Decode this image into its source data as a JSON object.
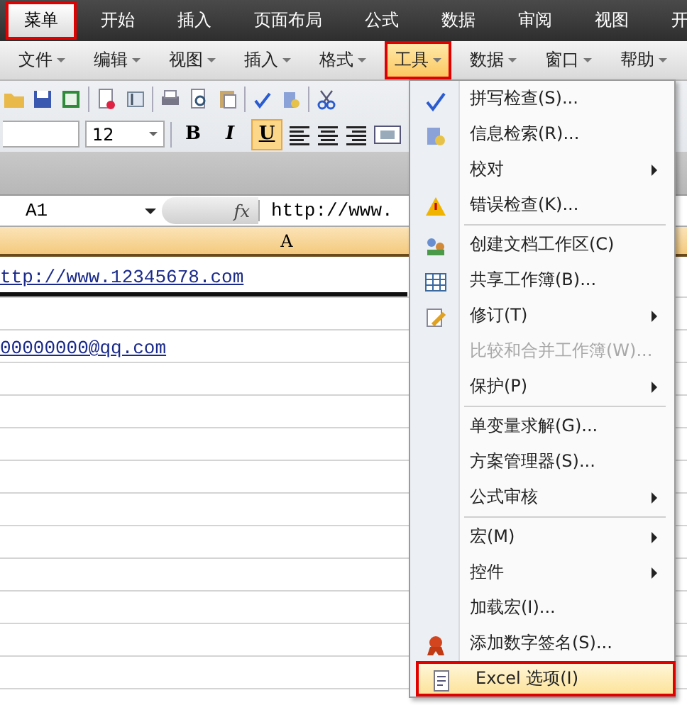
{
  "ribbon_tabs": [
    {
      "label": "菜单",
      "selected": true,
      "annotated": true
    },
    {
      "label": "开始",
      "selected": false,
      "annotated": false
    },
    {
      "label": "插入",
      "selected": false,
      "annotated": false
    },
    {
      "label": "页面布局",
      "selected": false,
      "annotated": false
    },
    {
      "label": "公式",
      "selected": false,
      "annotated": false
    },
    {
      "label": "数据",
      "selected": false,
      "annotated": false
    },
    {
      "label": "审阅",
      "selected": false,
      "annotated": false
    },
    {
      "label": "视图",
      "selected": false,
      "annotated": false
    },
    {
      "label": "开",
      "selected": false,
      "annotated": false
    }
  ],
  "menu_bar": [
    {
      "label": "文件",
      "selected": false,
      "annotated": false
    },
    {
      "label": "编辑",
      "selected": false,
      "annotated": false
    },
    {
      "label": "视图",
      "selected": false,
      "annotated": false
    },
    {
      "label": "插入",
      "selected": false,
      "annotated": false
    },
    {
      "label": "格式",
      "selected": false,
      "annotated": false
    },
    {
      "label": "工具",
      "selected": true,
      "annotated": true
    },
    {
      "label": "数据",
      "selected": false,
      "annotated": false
    },
    {
      "label": "窗口",
      "selected": false,
      "annotated": false
    },
    {
      "label": "帮助",
      "selected": false,
      "annotated": false
    }
  ],
  "font_size": {
    "value": "12"
  },
  "format_buttons": [
    {
      "label": "B",
      "pressed": false
    },
    {
      "label": "I",
      "pressed": false
    },
    {
      "label": "U",
      "pressed": true
    }
  ],
  "name_box": {
    "value": "A1"
  },
  "formula_bar": {
    "function_label": "fx",
    "value": "http://www."
  },
  "column_header": "A",
  "rows": [
    {
      "text": "ttp://www.12345678.com",
      "selected": true
    },
    null,
    {
      "text": "00000000@qq.com",
      "selected": false
    }
  ],
  "tools_menu": [
    {
      "kind": "item",
      "label": "拼写检查(S)...",
      "has_icon": true,
      "submenu": false,
      "disabled": false,
      "annotated": false
    },
    {
      "kind": "item",
      "label": "信息检索(R)...",
      "has_icon": true,
      "submenu": false,
      "disabled": false,
      "annotated": false
    },
    {
      "kind": "item",
      "label": "校对",
      "has_icon": false,
      "submenu": true,
      "disabled": false,
      "annotated": false
    },
    {
      "kind": "item",
      "label": "错误检查(K)...",
      "has_icon": true,
      "submenu": false,
      "disabled": false,
      "annotated": false
    },
    {
      "kind": "separator"
    },
    {
      "kind": "item",
      "label": "创建文档工作区(C)",
      "has_icon": true,
      "submenu": false,
      "disabled": false,
      "annotated": false
    },
    {
      "kind": "item",
      "label": "共享工作簿(B)...",
      "has_icon": true,
      "submenu": false,
      "disabled": false,
      "annotated": false
    },
    {
      "kind": "item",
      "label": "修订(T)",
      "has_icon": true,
      "submenu": true,
      "disabled": false,
      "annotated": false
    },
    {
      "kind": "item",
      "label": "比较和合并工作簿(W)...",
      "has_icon": false,
      "submenu": false,
      "disabled": true,
      "annotated": false
    },
    {
      "kind": "item",
      "label": "保护(P)",
      "has_icon": false,
      "submenu": true,
      "disabled": false,
      "annotated": false
    },
    {
      "kind": "separator"
    },
    {
      "kind": "item",
      "label": "单变量求解(G)...",
      "has_icon": false,
      "submenu": false,
      "disabled": false,
      "annotated": false
    },
    {
      "kind": "item",
      "label": "方案管理器(S)...",
      "has_icon": false,
      "submenu": false,
      "disabled": false,
      "annotated": false
    },
    {
      "kind": "item",
      "label": "公式审核",
      "has_icon": false,
      "submenu": true,
      "disabled": false,
      "annotated": false
    },
    {
      "kind": "separator"
    },
    {
      "kind": "item",
      "label": "宏(M)",
      "has_icon": false,
      "submenu": true,
      "disabled": false,
      "annotated": false
    },
    {
      "kind": "item",
      "label": "控件",
      "has_icon": false,
      "submenu": true,
      "disabled": false,
      "annotated": false
    },
    {
      "kind": "item",
      "label": "加载宏(I)...",
      "has_icon": false,
      "submenu": false,
      "disabled": false,
      "annotated": false
    },
    {
      "kind": "item",
      "label": "添加数字签名(S)...",
      "has_icon": true,
      "submenu": false,
      "disabled": false,
      "annotated": false
    },
    {
      "kind": "item",
      "label": "Excel 选项(I)",
      "has_icon": true,
      "submenu": false,
      "disabled": false,
      "annotated": true
    }
  ]
}
